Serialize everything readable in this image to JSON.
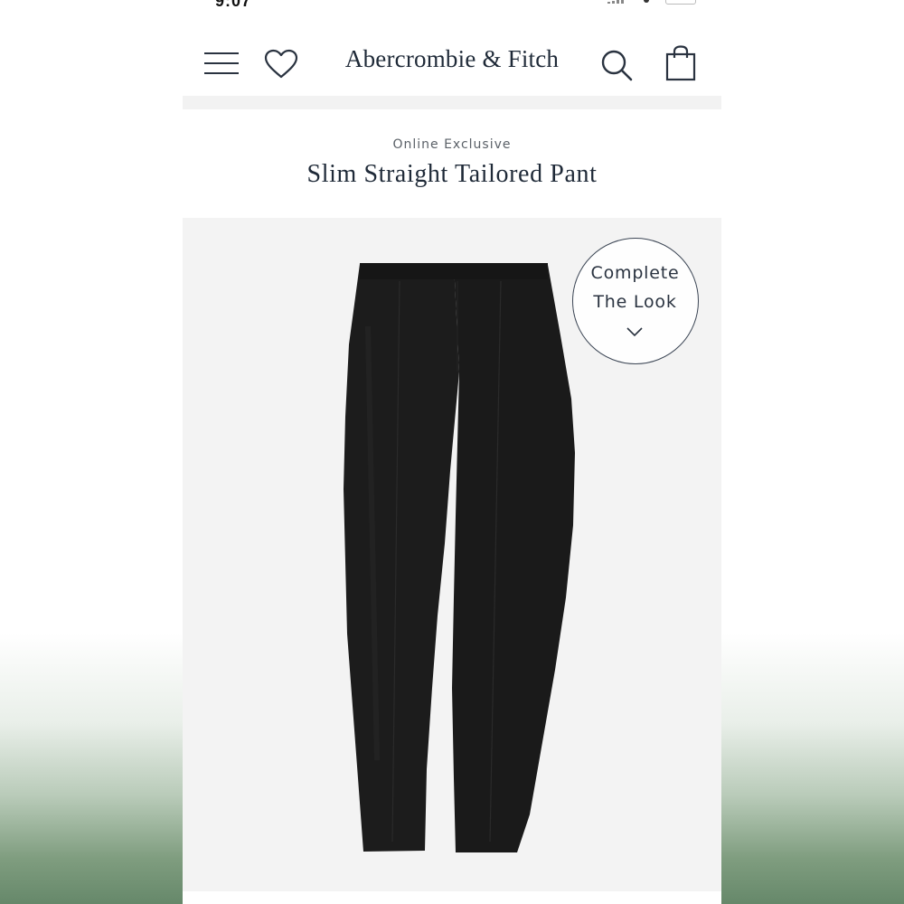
{
  "status_bar": {
    "time": "9:07"
  },
  "header": {
    "brand": "Abercrombie & Fitch",
    "icons": {
      "menu": "hamburger-icon",
      "wishlist": "heart-icon",
      "search": "search-icon",
      "bag": "shopping-bag-icon"
    }
  },
  "product": {
    "eyebrow": "Online Exclusive",
    "title": "Slim Straight Tailored Pant",
    "image_subject": "black tailored pants"
  },
  "complete_the_look": {
    "line1": "Complete",
    "line2": "The Look",
    "icon": "chevron-down-icon"
  },
  "colors": {
    "brand_navy": "#1f2a38",
    "pant_black": "#1a1a1a",
    "image_bg": "#f3f3f3"
  }
}
